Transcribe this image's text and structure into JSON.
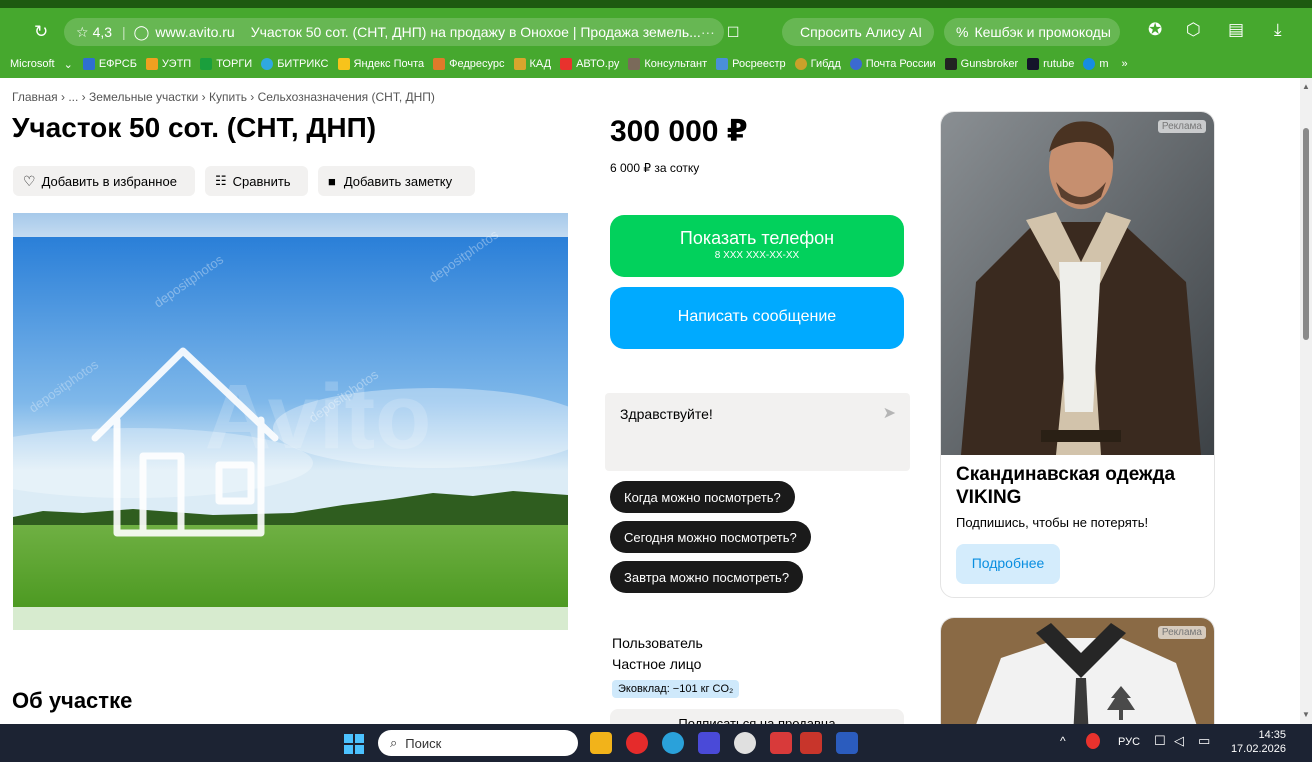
{
  "browser": {
    "rating": "4,3",
    "domain": "www.avito.ru",
    "tab_title": "Участок 50 сот. (СНТ, ДНП) на продажу в Онохое | Продажа земель...",
    "ask_alice": "Спросить Алису AI",
    "cashback": "Кешбэк и промокоды",
    "bookmarks": [
      "Microsoft",
      "ЕФРСБ",
      "УЭТП",
      "ТОРГИ",
      "БИТРИКС",
      "Яндекс Почта",
      "Федресурс",
      "КАД",
      "АВТО.ру",
      "Консультант",
      "Росреестр",
      "Гибдд",
      "Почта России",
      "Gunsbroker",
      "rutube",
      "m"
    ],
    "colors": {
      "bar": "#46a82e",
      "topline": "#1d5a10"
    }
  },
  "listing": {
    "breadcrumbs": "Главная › ... › Земельные участки › Купить › Сельхозназначения (СНТ, ДНП)",
    "title": "Участок 50 сот. (СНТ, ДНП)",
    "actions": {
      "favorite": "Добавить в избранное",
      "compare": "Сравнить",
      "note": "Добавить заметку"
    },
    "photo_watermark": "Avito",
    "price": "300 000 ₽",
    "price_per_unit": "6 000 ₽ за сотку",
    "show_phone": "Показать телефон",
    "phone_masked": "8 XXX XXX-XX-XX",
    "write_message": "Написать сообщение",
    "message_draft": "Здравствуйте!",
    "quick_questions": [
      "Когда можно посмотреть?",
      "Сегодня можно посмотреть?",
      "Завтра можно посмотреть?"
    ],
    "seller_name": "Пользователь",
    "seller_type": "Частное лицо",
    "eco_badge": "Эковклад: −101 кг CO₂",
    "subscribe": "Подписаться на продавца",
    "about_heading": "Об участке",
    "colors": {
      "green_button": "#02d15c",
      "blue_button": "#00aaff"
    }
  },
  "ads": [
    {
      "tag": "Реклама",
      "title": "Скандинавская одежда VIKING",
      "subtitle": "Подпишись, чтобы не потерять!",
      "button": "Подробнее"
    },
    {
      "tag": "Реклама"
    }
  ],
  "taskbar": {
    "search_placeholder": "Поиск",
    "language": "РУС",
    "time": "14:35",
    "date": "17.02.2026"
  }
}
